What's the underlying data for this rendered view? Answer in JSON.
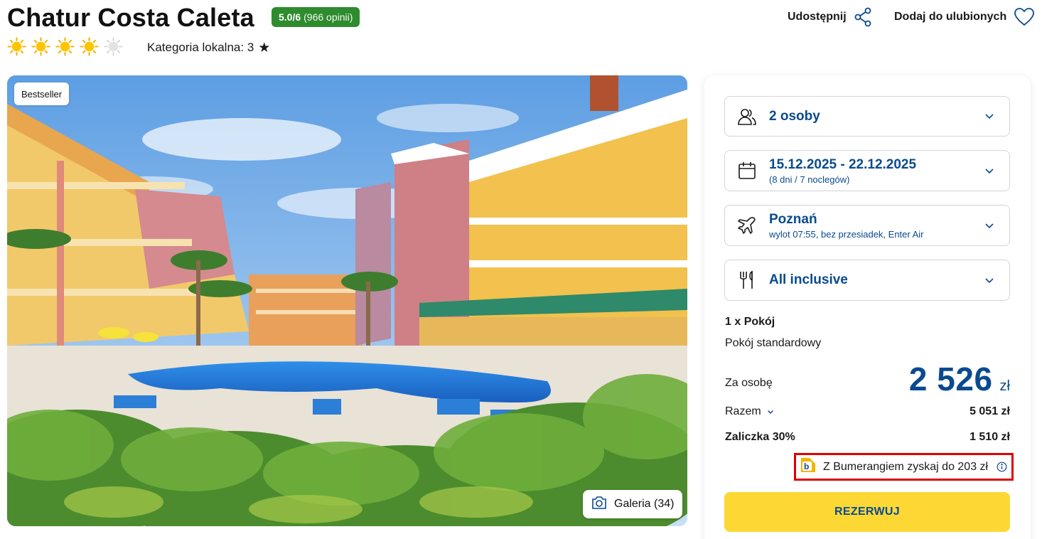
{
  "hotel": {
    "name": "Chatur Costa Caleta",
    "rating_score": "5.0/6",
    "rating_reviews": "(966 opinii)",
    "sun_rating": 4,
    "sun_rating_max": 5,
    "local_category_label": "Kategoria lokalna: 3"
  },
  "actions": {
    "share_label": "Udostępnij",
    "favorite_label": "Dodaj do ulubionych"
  },
  "hero": {
    "badge": "Bestseller",
    "gallery_label": "Galeria (34)"
  },
  "booking": {
    "persons": "2 osoby",
    "dates": "15.12.2025 - 22.12.2025",
    "duration": "(8 dni / 7 noclegów)",
    "departure_city": "Poznań",
    "flight_info": "wylot 07:55, bez przesiadek, Enter Air",
    "board": "All inclusive",
    "room_count": "1 x Pokój",
    "room_type": "Pokój standardowy",
    "per_person_label": "Za osobę",
    "per_person_price": "2 526",
    "currency": "zł",
    "total_label": "Razem",
    "total_value": "5 051 zł",
    "deposit_label": "Zaliczka 30%",
    "deposit_value": "1 510 zł",
    "bumerang_text": "Z Bumerangiem zyskaj do 203 zł",
    "reserve_label": "REZERWUJ"
  },
  "colors": {
    "brand_blue": "#0a4a8f",
    "rating_green": "#2e8b2e",
    "cta_yellow": "#fdd835",
    "highlight_red": "#e00000"
  },
  "icons": [
    "sun-icon",
    "star-icon",
    "share-icon",
    "heart-icon",
    "camera-icon",
    "users-icon",
    "calendar-icon",
    "plane-icon",
    "cutlery-icon",
    "chevron-down-icon",
    "bumerang-logo",
    "info-icon"
  ]
}
